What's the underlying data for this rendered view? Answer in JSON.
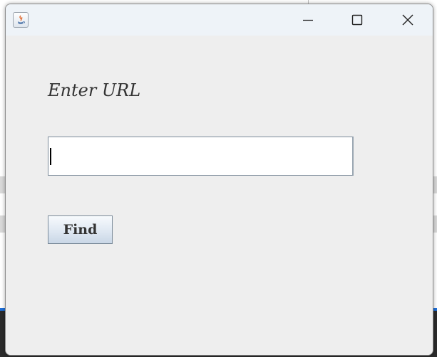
{
  "window": {
    "title": "",
    "controls": {
      "minimize_icon": "minimize-icon",
      "maximize_icon": "maximize-icon",
      "close_icon": "close-icon"
    }
  },
  "form": {
    "prompt_label": "Enter URL",
    "url_value": "",
    "find_label": "Find"
  },
  "colors": {
    "window_bg": "#eeeeee",
    "titlebar_bg": "#eef3f8",
    "text": "#333333"
  }
}
